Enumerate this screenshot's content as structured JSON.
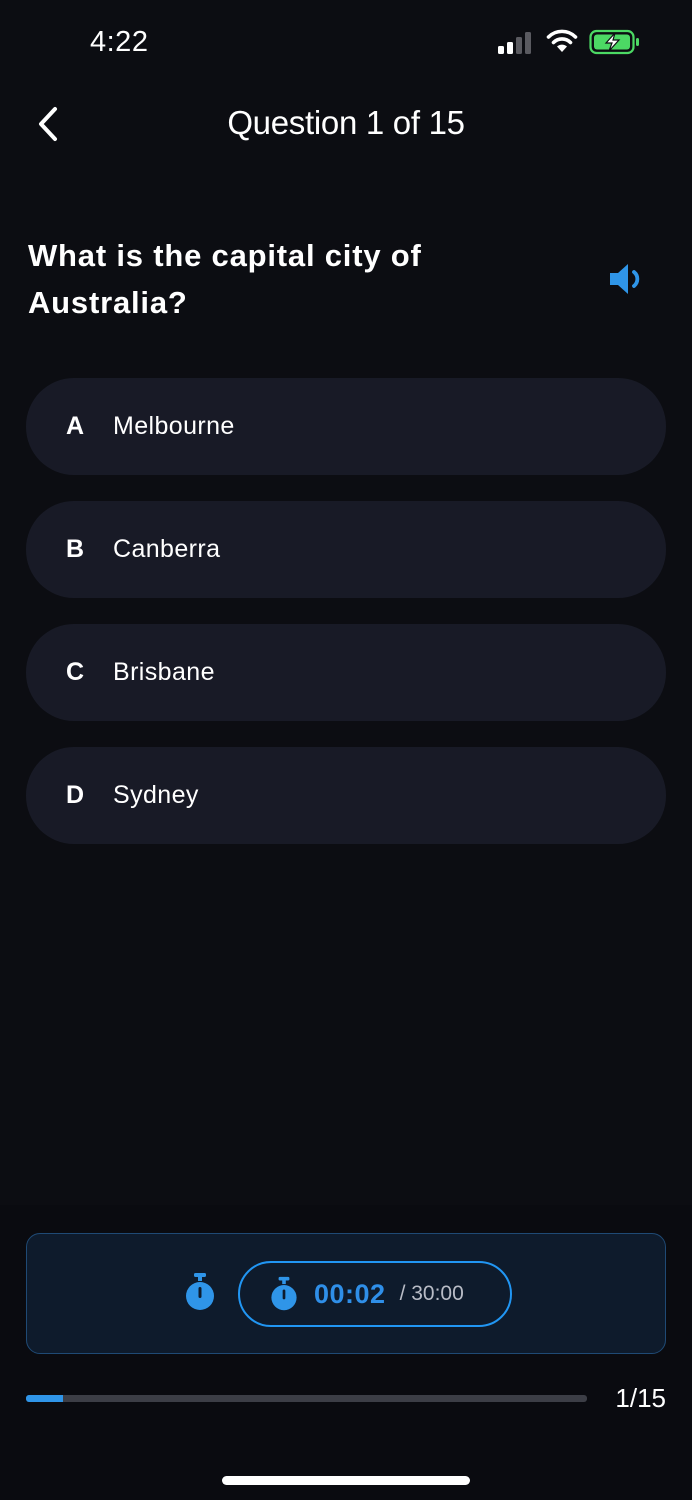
{
  "status_bar": {
    "time": "4:22",
    "icons": [
      "signal-icon",
      "wifi-icon",
      "battery-charging-icon"
    ],
    "battery_color": "#4cd964"
  },
  "nav": {
    "back_icon": "chevron-left-icon",
    "title": "Question 1 of 15"
  },
  "question": {
    "text": "What is the capital city of Australia?",
    "audio_icon": "speaker-icon"
  },
  "options": [
    {
      "letter": "A",
      "text": "Melbourne"
    },
    {
      "letter": "B",
      "text": "Canberra"
    },
    {
      "letter": "C",
      "text": "Brisbane"
    },
    {
      "letter": "D",
      "text": "Sydney"
    }
  ],
  "timer": {
    "icon": "stopwatch-icon",
    "elapsed": "00:02",
    "total": "/ 30:00"
  },
  "progress": {
    "current": 1,
    "total": 15,
    "label": "1/15"
  },
  "colors": {
    "background": "#0c0d12",
    "option_bg": "#181a26",
    "accent": "#2196f3"
  }
}
